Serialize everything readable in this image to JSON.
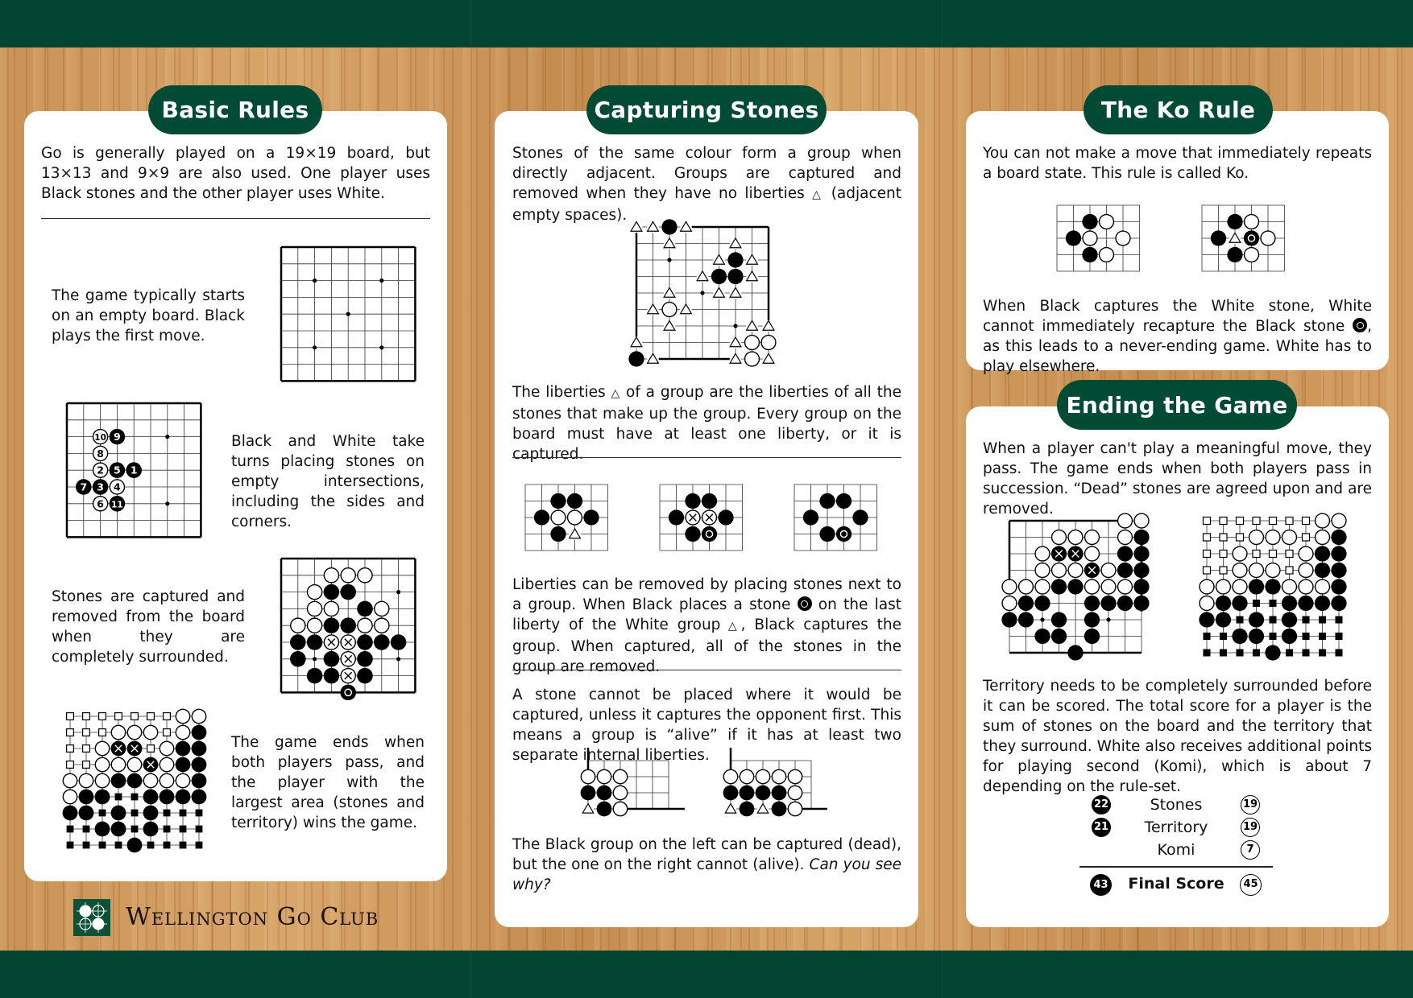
{
  "club_name": "Wellington Go Club",
  "colors": {
    "brand_green": "#014530",
    "pill_green": "#014a33",
    "wood": "#c99256"
  },
  "basic_rules": {
    "title": "Basic Rules",
    "intro": "Go is generally played on a 19×19 board, but 13×13 and 9×9 are also used. One player uses Black stones and the other player uses White.",
    "step1": "The game typically starts on an empty board. Black plays the first move.",
    "step2": "Black and White take turns placing stones on empty intersections, including the sides and corners.",
    "step3": "Stones are captured and removed from the board when they are completely surrounded.",
    "step4": "The game ends when both players pass, and the player with the largest area (stones and territory) wins the game.",
    "move_numbers": {
      "black": [
        "1",
        "3",
        "5",
        "7",
        "9",
        "11"
      ],
      "white": [
        "2",
        "4",
        "6",
        "8",
        "10"
      ]
    }
  },
  "capturing": {
    "title": "Capturing Stones",
    "p1_a": "Stones of the same colour form a group when directly adjacent. Groups are captured and removed when they have no liberties",
    "p1_b": "(adjacent empty spaces).",
    "p2_a": "The liberties",
    "p2_b": "of a group are the liberties of all the stones that make up the group. Every group on the board must have at least one liberty, or it is captured.",
    "p3_a": "Liberties can be removed by placing stones next to a group. When Black places a stone",
    "p3_b": "on the last liberty of the White group",
    "p3_c": ", Black captures the group. When captured, all of the stones in the group are removed.",
    "p4": "A stone cannot be placed where it would be captured, unless it captures the opponent first. This means a group is “alive” if it has at least two separate internal liberties.",
    "p5_a": "The Black group on the left can be captured (dead), but the one on the right cannot (alive).",
    "p5_b": "Can you see why?"
  },
  "ko": {
    "title": "The Ko Rule",
    "p1": "You can not make a move that immediately repeats a board state. This rule is called Ko.",
    "p2_a": "When Black captures the White stone, White cannot immediately recapture the Black stone",
    "p2_b": ", as this leads to a never-ending game. White has to play elsewhere."
  },
  "ending": {
    "title": "Ending the Game",
    "p1": "When a player can't play a meaningful move, they pass. The game ends when both players pass in succession. “Dead” stones are agreed upon and are removed.",
    "p2": "Territory needs to be completely surrounded before it can be scored. The total score for a player is the sum of stones on the board and the territory that they surround. White also receives additional points for playing second (Komi), which is about 7 depending on the rule-set.",
    "score": [
      {
        "label": "Stones",
        "black": "22",
        "white": "19"
      },
      {
        "label": "Territory",
        "black": "21",
        "white": "19"
      },
      {
        "label": "Komi",
        "black": null,
        "white": "7"
      }
    ],
    "final": {
      "label": "Final Score",
      "black": "43",
      "white": "45"
    }
  },
  "icons": {
    "liberty": "triangle-icon",
    "captured": "x-mark-icon",
    "last_move": "circle-mark-icon",
    "territory": "square-icon"
  }
}
